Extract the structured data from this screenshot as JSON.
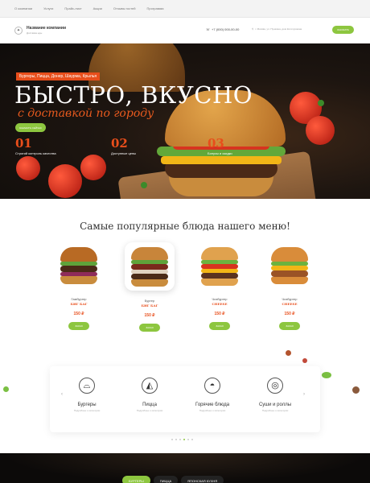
{
  "topnav": [
    "О компании",
    "Услуги",
    "Прайс-лист",
    "Акции",
    "Отзывы гостей",
    "Программа"
  ],
  "header": {
    "company_name": "Название компании",
    "company_sub": "Доставка еды",
    "phone": "+7 (000) 000-00-00",
    "address": "г. Москва, ул. Пушкина, дом Колотушкина",
    "call_button": "ЗАКАЗАТЬ"
  },
  "hero": {
    "tag": "Бургеры, Пицца, Донер, Шаурма, Крылья",
    "title": "БЫСТРО, ВКУСНО",
    "script": "с доставкой по городу",
    "button": "ЗАКАЗАТЬ СЕЙЧАС",
    "features": [
      {
        "num": "01",
        "label": "Строгий контроль качества"
      },
      {
        "num": "02",
        "label": "Доступные цены"
      },
      {
        "num": "03",
        "label": "Бонусы и скидки"
      }
    ]
  },
  "popular": {
    "title": "Самые популярные блюда нашего меню!",
    "items": [
      {
        "name": "Гамбургер",
        "title": "БИГ БАГ",
        "price": "150 ₽",
        "button": "ЗАКАЗ"
      },
      {
        "name": "Бургер",
        "title": "БИГ БАГ",
        "price": "150 ₽",
        "button": "ЗАКАЗ"
      },
      {
        "name": "Чизбургер",
        "title": "CHEESE",
        "price": "150 ₽",
        "button": "ЗАКАЗ"
      },
      {
        "name": "Чизбургер",
        "title": "CHEESE",
        "price": "150 ₽",
        "button": "ЗАКАЗ"
      }
    ]
  },
  "categories": [
    {
      "title": "Бургеры",
      "sub": "Подробнее о категории",
      "icon": "burger-icon"
    },
    {
      "title": "Пицца",
      "sub": "Подробнее о категории",
      "icon": "pizza-icon"
    },
    {
      "title": "Горячие блюда",
      "sub": "Подробнее о категории",
      "icon": "hot-dish-icon"
    },
    {
      "title": "Суши и роллы",
      "sub": "Подробнее о категории",
      "icon": "sushi-icon"
    }
  ],
  "bottom_tabs": [
    "БУРГЕРЫ",
    "ПИЦЦА",
    "ЯПОНСКАЯ КУХНЯ"
  ],
  "colors": {
    "accent": "#8dc63f",
    "orange": "#e84e1b",
    "dark": "#0f0c0a"
  }
}
